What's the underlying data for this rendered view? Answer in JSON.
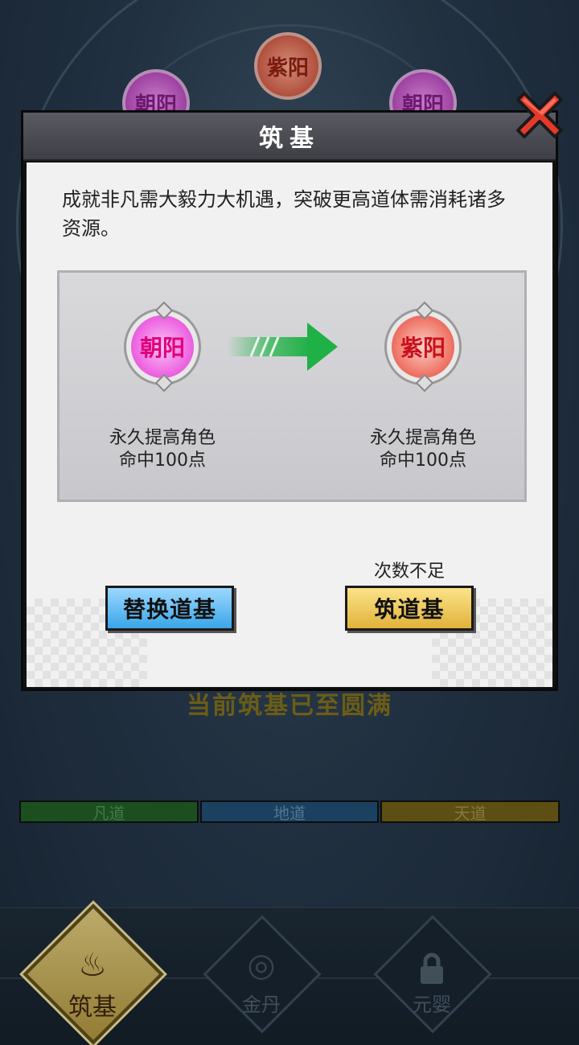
{
  "background": {
    "top_orbs": [
      "朝阳",
      "紫阳",
      "朝阳"
    ],
    "progress_text": "当前筑基已至圆满",
    "paths": [
      "凡道",
      "地道",
      "天道"
    ]
  },
  "bottom_nav": {
    "items": [
      {
        "label": "筑基",
        "icon": "lotus-flame-icon",
        "active": true
      },
      {
        "label": "金丹",
        "icon": "swirl-icon",
        "active": false
      },
      {
        "label": "元婴",
        "icon": "lock-icon",
        "active": false
      }
    ]
  },
  "dialog": {
    "title": "筑基",
    "description": "成就非凡需大毅力大机遇，突破更高道体需消耗诸多资源。",
    "current": {
      "orb": "朝阳",
      "effect_line1": "永久提高角色",
      "effect_line2": "命中100点"
    },
    "next": {
      "orb": "紫阳",
      "effect_line1": "永久提高角色",
      "effect_line2": "命中100点"
    },
    "replace_button": "替换道基",
    "build_button": "筑道基",
    "insufficient_text": "次数不足",
    "close_icon": "close-x-icon"
  },
  "colors": {
    "accent_red": "#e53a2a",
    "arrow_green": "#22b34a",
    "button_blue": "#3aa6e8",
    "button_gold": "#e2b23a"
  }
}
